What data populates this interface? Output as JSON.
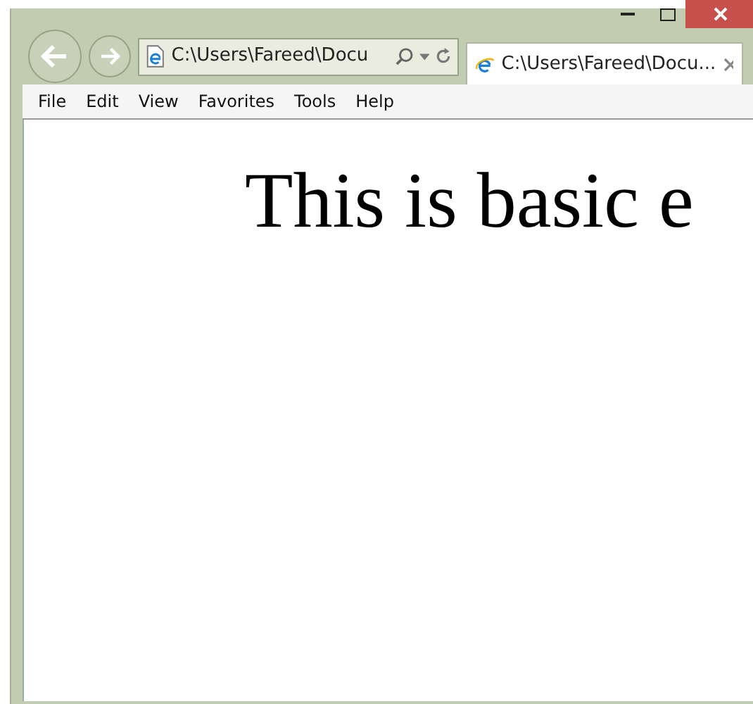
{
  "address_bar": {
    "value": "C:\\Users\\Fareed\\Docu"
  },
  "tabs": [
    {
      "label": "C:\\Users\\Fareed\\Docu...",
      "selected": true
    }
  ],
  "menu": [
    "File",
    "Edit",
    "View",
    "Favorites",
    "Tools",
    "Help"
  ],
  "page": {
    "heading": "This is basic e"
  }
}
